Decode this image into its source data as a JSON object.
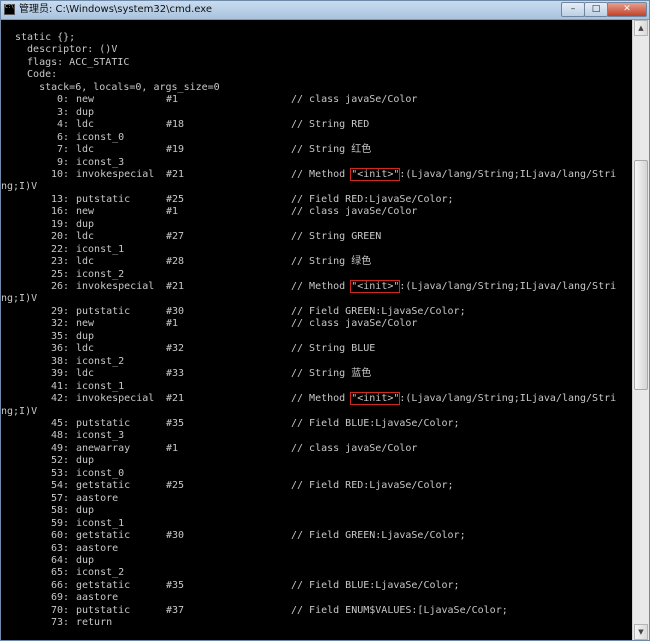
{
  "window": {
    "title": "管理员: C:\\Windows\\system32\\cmd.exe",
    "minimize_glyph": "–",
    "maximize_glyph": "□",
    "close_glyph": "✕"
  },
  "header": [
    "static {};",
    "  descriptor: ()V",
    "  flags: ACC_STATIC",
    "  Code:",
    "    stack=6, locals=0, args_size=0"
  ],
  "instructions": [
    {
      "offset": "0:",
      "op": "new",
      "arg": "#1",
      "comment": "// class javaSe/Color"
    },
    {
      "offset": "3:",
      "op": "dup",
      "arg": "",
      "comment": ""
    },
    {
      "offset": "4:",
      "op": "ldc",
      "arg": "#18",
      "comment": "// String RED"
    },
    {
      "offset": "6:",
      "op": "iconst_0",
      "arg": "",
      "comment": ""
    },
    {
      "offset": "7:",
      "op": "ldc",
      "arg": "#19",
      "comment": "// String 红色"
    },
    {
      "offset": "9:",
      "op": "iconst_3",
      "arg": "",
      "comment": ""
    },
    {
      "offset": "10:",
      "op": "invokespecial",
      "arg": "#21",
      "comment_pre": "// Method ",
      "init": "\"<init>\"",
      "comment_post": ":(Ljava/lang/String;ILjava/lang/Stri",
      "wrap": "ng;I)V"
    },
    {
      "offset": "13:",
      "op": "putstatic",
      "arg": "#25",
      "comment": "// Field RED:LjavaSe/Color;"
    },
    {
      "offset": "16:",
      "op": "new",
      "arg": "#1",
      "comment": "// class javaSe/Color"
    },
    {
      "offset": "19:",
      "op": "dup",
      "arg": "",
      "comment": ""
    },
    {
      "offset": "20:",
      "op": "ldc",
      "arg": "#27",
      "comment": "// String GREEN"
    },
    {
      "offset": "22:",
      "op": "iconst_1",
      "arg": "",
      "comment": ""
    },
    {
      "offset": "23:",
      "op": "ldc",
      "arg": "#28",
      "comment": "// String 绿色"
    },
    {
      "offset": "25:",
      "op": "iconst_2",
      "arg": "",
      "comment": ""
    },
    {
      "offset": "26:",
      "op": "invokespecial",
      "arg": "#21",
      "comment_pre": "// Method ",
      "init": "\"<init>\"",
      "comment_post": ":(Ljava/lang/String;ILjava/lang/Stri",
      "wrap": "ng;I)V"
    },
    {
      "offset": "29:",
      "op": "putstatic",
      "arg": "#30",
      "comment": "// Field GREEN:LjavaSe/Color;"
    },
    {
      "offset": "32:",
      "op": "new",
      "arg": "#1",
      "comment": "// class javaSe/Color"
    },
    {
      "offset": "35:",
      "op": "dup",
      "arg": "",
      "comment": ""
    },
    {
      "offset": "36:",
      "op": "ldc",
      "arg": "#32",
      "comment": "// String BLUE"
    },
    {
      "offset": "38:",
      "op": "iconst_2",
      "arg": "",
      "comment": ""
    },
    {
      "offset": "39:",
      "op": "ldc",
      "arg": "#33",
      "comment": "// String 蓝色"
    },
    {
      "offset": "41:",
      "op": "iconst_1",
      "arg": "",
      "comment": ""
    },
    {
      "offset": "42:",
      "op": "invokespecial",
      "arg": "#21",
      "comment_pre": "// Method ",
      "init": "\"<init>\"",
      "comment_post": ":(Ljava/lang/String;ILjava/lang/Stri",
      "wrap": "ng;I)V"
    },
    {
      "offset": "45:",
      "op": "putstatic",
      "arg": "#35",
      "comment": "// Field BLUE:LjavaSe/Color;"
    },
    {
      "offset": "48:",
      "op": "iconst_3",
      "arg": "",
      "comment": ""
    },
    {
      "offset": "49:",
      "op": "anewarray",
      "arg": "#1",
      "comment": "// class javaSe/Color"
    },
    {
      "offset": "52:",
      "op": "dup",
      "arg": "",
      "comment": ""
    },
    {
      "offset": "53:",
      "op": "iconst_0",
      "arg": "",
      "comment": ""
    },
    {
      "offset": "54:",
      "op": "getstatic",
      "arg": "#25",
      "comment": "// Field RED:LjavaSe/Color;"
    },
    {
      "offset": "57:",
      "op": "aastore",
      "arg": "",
      "comment": ""
    },
    {
      "offset": "58:",
      "op": "dup",
      "arg": "",
      "comment": ""
    },
    {
      "offset": "59:",
      "op": "iconst_1",
      "arg": "",
      "comment": ""
    },
    {
      "offset": "60:",
      "op": "getstatic",
      "arg": "#30",
      "comment": "// Field GREEN:LjavaSe/Color;"
    },
    {
      "offset": "63:",
      "op": "aastore",
      "arg": "",
      "comment": ""
    },
    {
      "offset": "64:",
      "op": "dup",
      "arg": "",
      "comment": ""
    },
    {
      "offset": "65:",
      "op": "iconst_2",
      "arg": "",
      "comment": ""
    },
    {
      "offset": "66:",
      "op": "getstatic",
      "arg": "#35",
      "comment": "// Field BLUE:LjavaSe/Color;"
    },
    {
      "offset": "69:",
      "op": "aastore",
      "arg": "",
      "comment": ""
    },
    {
      "offset": "70:",
      "op": "putstatic",
      "arg": "#37",
      "comment": "// Field ENUM$VALUES:[LjavaSe/Color;"
    },
    {
      "offset": "73:",
      "op": "return",
      "arg": "",
      "comment": ""
    }
  ],
  "colors": {
    "console_bg": "#000000",
    "console_text": "#c8c8c8",
    "highlight_box": "#d0281c"
  }
}
